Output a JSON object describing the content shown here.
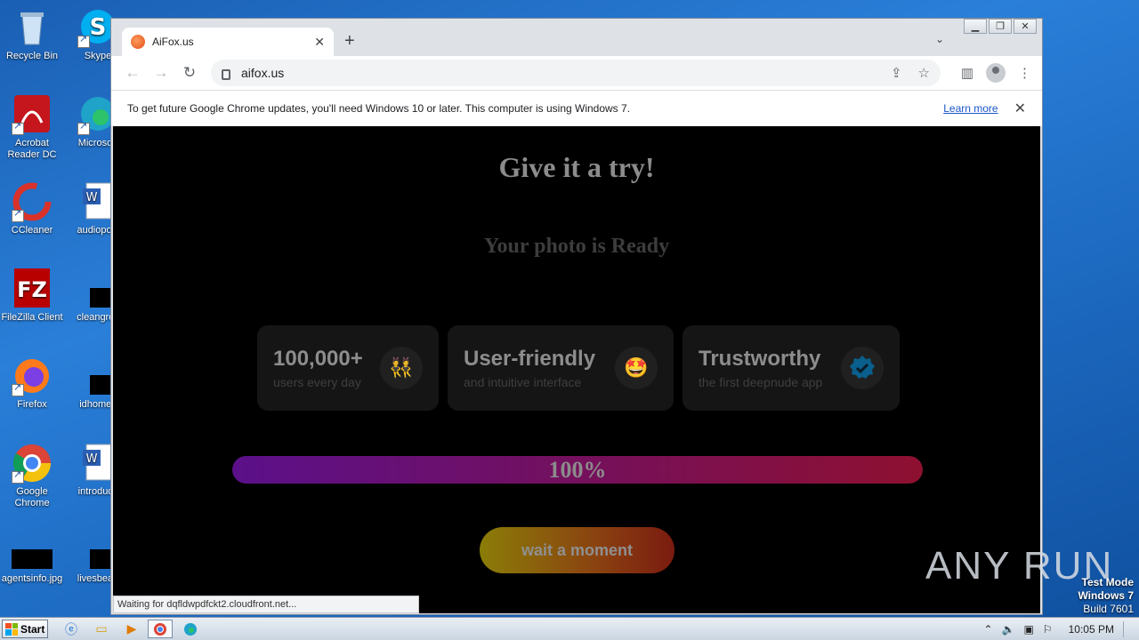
{
  "desktop": {
    "icons": [
      {
        "label": "Recycle Bin"
      },
      {
        "label": "Skype"
      },
      {
        "label": "Acrobat Reader DC"
      },
      {
        "label": "Microsoft"
      },
      {
        "label": "CCleaner"
      },
      {
        "label": "audiopolit"
      },
      {
        "label": "FileZilla Client"
      },
      {
        "label": "cleangrov"
      },
      {
        "label": "Firefox"
      },
      {
        "label": "idhomes"
      },
      {
        "label": "Google Chrome"
      },
      {
        "label": "introducti"
      },
      {
        "label": "agentsinfo.jpg"
      },
      {
        "label": "livesbead"
      }
    ]
  },
  "browser": {
    "tab_title": "AiFox.us",
    "url": "aifox.us",
    "infobar_message": "To get future Google Chrome updates, you'll need Windows 10 or later. This computer is using Windows 7.",
    "infobar_link": "Learn more",
    "status_text": "Waiting for dqfldwpdfckt2.cloudfront.net..."
  },
  "page": {
    "headline": "Give it a try!",
    "subheadline": "Your photo is Ready",
    "cards": [
      {
        "big": "100,000+",
        "small": "users every day",
        "icon": "people-emoji"
      },
      {
        "big": "User-friendly",
        "small": "and intuitive interface",
        "icon": "star-eyes-emoji"
      },
      {
        "big": "Trustworthy",
        "small": "the first deepnude app",
        "icon": "verified-badge-icon"
      }
    ],
    "progress_percent": 100,
    "progress_label": "100%",
    "cta_label": "wait a moment",
    "colors": {
      "progress_start": "#5b108a",
      "progress_end": "#8e1030"
    }
  },
  "watermark": {
    "text": "ANY RUN"
  },
  "os": {
    "test_mode_line1": "Test Mode",
    "test_mode_line2": "Windows 7",
    "test_mode_line3": "Build 7601",
    "start_label": "Start",
    "clock": "10:05 PM"
  }
}
